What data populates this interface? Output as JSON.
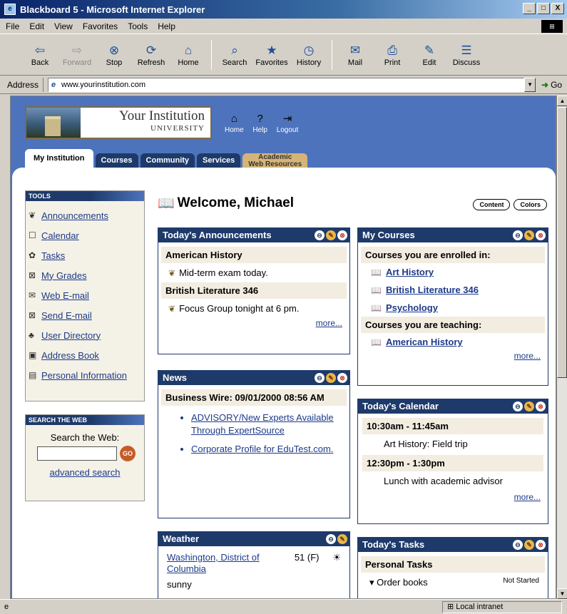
{
  "window": {
    "title": "Blackboard 5 - Microsoft Internet Explorer",
    "controls": [
      "_",
      "□",
      "X"
    ]
  },
  "menu": [
    "File",
    "Edit",
    "View",
    "Favorites",
    "Tools",
    "Help"
  ],
  "toolbar": [
    {
      "label": "Back",
      "icon": "back-arrow-icon",
      "glyph": "⇦"
    },
    {
      "label": "Forward",
      "icon": "forward-arrow-icon",
      "glyph": "⇨"
    },
    {
      "label": "Stop",
      "icon": "stop-icon",
      "glyph": "⊗"
    },
    {
      "label": "Refresh",
      "icon": "refresh-icon",
      "glyph": "⟳"
    },
    {
      "label": "Home",
      "icon": "home-icon",
      "glyph": "⌂"
    },
    {
      "label": "Search",
      "icon": "search-icon",
      "glyph": "⌕"
    },
    {
      "label": "Favorites",
      "icon": "favorites-icon",
      "glyph": "★"
    },
    {
      "label": "History",
      "icon": "history-icon",
      "glyph": "◷"
    },
    {
      "label": "Mail",
      "icon": "mail-icon",
      "glyph": "✉"
    },
    {
      "label": "Print",
      "icon": "print-icon",
      "glyph": "⎙"
    },
    {
      "label": "Edit",
      "icon": "edit-icon",
      "glyph": "✎"
    },
    {
      "label": "Discuss",
      "icon": "discuss-icon",
      "glyph": "☰"
    }
  ],
  "address": {
    "label": "Address",
    "url": "www.yourinstitution.com",
    "go": "Go"
  },
  "site": {
    "logo_line1": "Your Institution",
    "logo_line2": "UNIVERSITY",
    "nav_icons": [
      {
        "label": "Home",
        "icon": "home-icon",
        "glyph": "⌂"
      },
      {
        "label": "Help",
        "icon": "help-icon",
        "glyph": "?"
      },
      {
        "label": "Logout",
        "icon": "logout-icon",
        "glyph": "⇥"
      }
    ],
    "tabs": [
      "My Institution",
      "Courses",
      "Community",
      "Services"
    ],
    "tab_extra_line1": "Academic",
    "tab_extra_line2": "Web Resources"
  },
  "tools": {
    "header": "TOOLS",
    "items": [
      {
        "label": "Announcements",
        "icon": "announcement-icon",
        "glyph": "❦"
      },
      {
        "label": "Calendar",
        "icon": "calendar-icon",
        "glyph": "☐"
      },
      {
        "label": "Tasks",
        "icon": "tasks-icon",
        "glyph": "✿"
      },
      {
        "label": "My Grades",
        "icon": "grades-icon",
        "glyph": "⊠"
      },
      {
        "label": "Web E-mail",
        "icon": "web-email-icon",
        "glyph": "✉"
      },
      {
        "label": "Send E-mail",
        "icon": "send-email-icon",
        "glyph": "⊠"
      },
      {
        "label": "User Directory",
        "icon": "user-directory-icon",
        "glyph": "♣"
      },
      {
        "label": "Address Book",
        "icon": "address-book-icon",
        "glyph": "▣"
      },
      {
        "label": "Personal Information",
        "icon": "personal-info-icon",
        "glyph": "▤"
      }
    ]
  },
  "search_web": {
    "header": "SEARCH THE WEB",
    "label": "Search the Web:",
    "go": "GO",
    "advanced": "advanced search"
  },
  "welcome": "Welcome, Michael",
  "buttons": {
    "content": "Content",
    "colors": "Colors"
  },
  "announcements": {
    "title": "Today's Announcements",
    "groups": [
      {
        "course": "American History",
        "text": "Mid-term exam today."
      },
      {
        "course": "British Literature 346",
        "text": "Focus Group tonight at 6 pm."
      }
    ],
    "more": "more..."
  },
  "courses": {
    "title": "My Courses",
    "enrolled_label": "Courses you are enrolled in:",
    "enrolled": [
      "Art History",
      "British Literature 346",
      "Psychology"
    ],
    "teaching_label": "Courses you are teaching:",
    "teaching": [
      "American History"
    ],
    "more": "more..."
  },
  "news": {
    "title": "News",
    "source": "Business Wire: 09/01/2000 08:56 AM",
    "items": [
      "ADVISORY/New Experts Available Through ExpertSource",
      "Corporate Profile for EduTest.com."
    ]
  },
  "calendar": {
    "title": "Today's Calendar",
    "events": [
      {
        "time": "10:30am - 11:45am",
        "text": "Art History: Field trip"
      },
      {
        "time": "12:30pm - 1:30pm",
        "text": "Lunch with academic advisor"
      }
    ],
    "more": "more..."
  },
  "weather": {
    "title": "Weather",
    "location": "Washington, District of Columbia",
    "temp": "51 (F)",
    "condition": "sunny"
  },
  "tasks": {
    "title": "Today's Tasks",
    "group": "Personal Tasks",
    "items": [
      {
        "text": "Order books",
        "status": "Not Started"
      }
    ]
  },
  "status": {
    "zone": "Local intranet"
  }
}
